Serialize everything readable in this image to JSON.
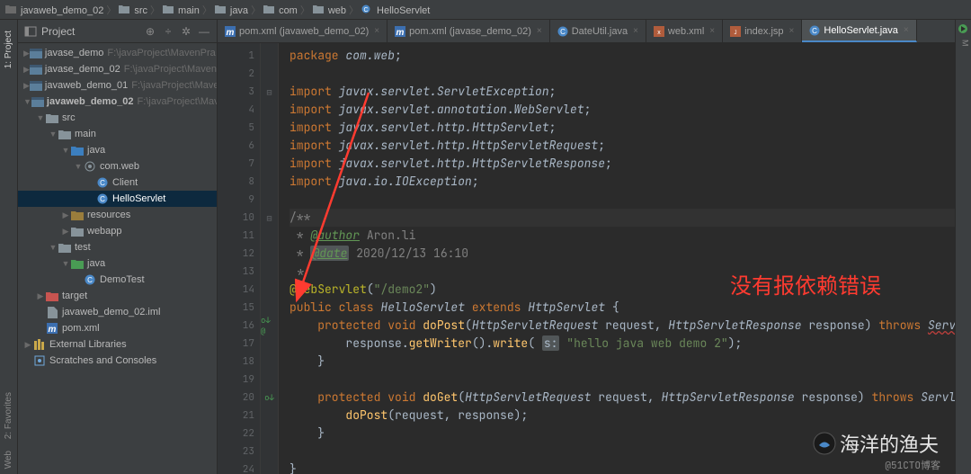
{
  "breadcrumb": [
    "javaweb_demo_02",
    "src",
    "main",
    "java",
    "com",
    "web",
    "HelloServlet"
  ],
  "project_panel": {
    "title": "Project",
    "tree": [
      {
        "depth": 0,
        "expand": "▶",
        "icon": "module",
        "label": "javase_demo",
        "dim": "F:\\javaProject\\MavenPra"
      },
      {
        "depth": 0,
        "expand": "▶",
        "icon": "module",
        "label": "javase_demo_02",
        "dim": "F:\\javaProject\\Maven"
      },
      {
        "depth": 0,
        "expand": "▶",
        "icon": "module",
        "label": "javaweb_demo_01",
        "dim": "F:\\javaProject\\Maver"
      },
      {
        "depth": 0,
        "expand": "▼",
        "icon": "module",
        "label": "javaweb_demo_02",
        "dim": "F:\\javaProject\\Maver",
        "bold": true
      },
      {
        "depth": 1,
        "expand": "▼",
        "icon": "folder",
        "label": "src"
      },
      {
        "depth": 2,
        "expand": "▼",
        "icon": "folder",
        "label": "main"
      },
      {
        "depth": 3,
        "expand": "▼",
        "icon": "src-folder",
        "label": "java"
      },
      {
        "depth": 4,
        "expand": "▼",
        "icon": "package",
        "label": "com.web"
      },
      {
        "depth": 5,
        "expand": "",
        "icon": "class",
        "label": "Client"
      },
      {
        "depth": 5,
        "expand": "",
        "icon": "class",
        "label": "HelloServlet",
        "sel": true
      },
      {
        "depth": 3,
        "expand": "▶",
        "icon": "res-folder",
        "label": "resources"
      },
      {
        "depth": 3,
        "expand": "▶",
        "icon": "folder",
        "label": "webapp"
      },
      {
        "depth": 2,
        "expand": "▼",
        "icon": "folder",
        "label": "test"
      },
      {
        "depth": 3,
        "expand": "▼",
        "icon": "test-folder",
        "label": "java"
      },
      {
        "depth": 4,
        "expand": "",
        "icon": "class",
        "label": "DemoTest"
      },
      {
        "depth": 1,
        "expand": "▶",
        "icon": "target",
        "label": "target"
      },
      {
        "depth": 1,
        "expand": "",
        "icon": "file",
        "label": "javaweb_demo_02.iml"
      },
      {
        "depth": 1,
        "expand": "",
        "icon": "maven",
        "label": "pom.xml"
      },
      {
        "depth": 0,
        "expand": "▶",
        "icon": "lib",
        "label": "External Libraries"
      },
      {
        "depth": 0,
        "expand": "",
        "icon": "scratch",
        "label": "Scratches and Consoles"
      }
    ]
  },
  "tabs": [
    {
      "icon": "maven",
      "label": "pom.xml (javaweb_demo_02)",
      "close": true
    },
    {
      "icon": "maven",
      "label": "pom.xml (javase_demo_02)",
      "close": true
    },
    {
      "icon": "class",
      "label": "DateUtil.java",
      "close": true
    },
    {
      "icon": "xml",
      "label": "web.xml",
      "close": true
    },
    {
      "icon": "jsp",
      "label": "index.jsp",
      "close": true
    },
    {
      "icon": "class",
      "label": "HelloServlet.java",
      "close": true,
      "active": true
    }
  ],
  "left_tool": [
    "1: Project",
    "2: Favorites",
    "Web"
  ],
  "code": {
    "lines": [
      {
        "n": 1,
        "html": "<span class='kw'>package</span> <span class='cls'>com.web</span>;"
      },
      {
        "n": 2,
        "html": ""
      },
      {
        "n": 3,
        "html": "<span class='kw'>import</span> <span class='cls'>javax.servlet.ServletException</span>;",
        "fold": "⊟"
      },
      {
        "n": 4,
        "html": "<span class='kw'>import</span> <span class='cls'>javax.servlet.annotation</span>.<span class='cls'>WebServlet</span>;"
      },
      {
        "n": 5,
        "html": "<span class='kw'>import</span> <span class='cls'>javax.servlet.http.HttpServlet</span>;"
      },
      {
        "n": 6,
        "html": "<span class='kw'>import</span> <span class='cls'>javax.servlet.http.HttpServletRequest</span>;"
      },
      {
        "n": 7,
        "html": "<span class='kw'>import</span> <span class='cls'>javax.servlet.http.HttpServletResponse</span>;"
      },
      {
        "n": 8,
        "html": "<span class='kw'>import</span> <span class='cls'>java.io.IOException</span>;"
      },
      {
        "n": 9,
        "html": ""
      },
      {
        "n": 10,
        "html": "<span class='line10'><span class='cmt'>/**</span></span>",
        "fold": "⊟"
      },
      {
        "n": 11,
        "html": "<span class='cmt'> * </span><span class='tag'>@author</span><span class='cmt'> Aron.li</span>"
      },
      {
        "n": 12,
        "html": "<span class='cmt'> * </span><span class='hlbox tag'>@date</span><span class='cmt'> 2020/12/13 16:10</span>"
      },
      {
        "n": 13,
        "html": "<span class='cmt'> */</span>"
      },
      {
        "n": 14,
        "html": "<span class='ann'>@WebServlet</span>(<span class='str'>\"/demo2\"</span>)"
      },
      {
        "n": 15,
        "html": "<span class='kw'>public class</span> <span class='cls'>HelloServlet</span> <span class='kw'>extends</span> <span class='cls'>HttpServlet</span> {"
      },
      {
        "n": 16,
        "html": "    <span class='kw'>protected</span> <span class='kw'>void</span> <span class='fn'>doPost</span>(<span class='cls'>HttpServletRequest</span> <span class='par'>request</span>, <span class='cls'>HttpServletResponse</span> <span class='par'>response</span>) <span class='kw'>throws</span> <span class='cls err-underline'>ServletEx</span>",
        "mark": "o↓ @"
      },
      {
        "n": 17,
        "html": "        <span class='par'>response</span>.<span class='fn'>getWriter</span>().<span class='fn'>write</span>( <span class='hlbox'>s:</span> <span class='str'>\"hello java web demo 2\"</span>);"
      },
      {
        "n": 18,
        "html": "    }"
      },
      {
        "n": 19,
        "html": ""
      },
      {
        "n": 20,
        "html": "    <span class='kw'>protected</span> <span class='kw'>void</span> <span class='fn'>doGet</span>(<span class='cls'>HttpServletRequest</span> <span class='par'>request</span>, <span class='cls'>HttpServletResponse</span> <span class='par'>response</span>) <span class='kw'>throws</span> <span class='cls'>ServletExc</span>",
        "mark": "o↓"
      },
      {
        "n": 21,
        "html": "        <span class='fn'>doPost</span>(<span class='par'>request</span>, <span class='par'>response</span>);"
      },
      {
        "n": 22,
        "html": "    }"
      },
      {
        "n": 23,
        "html": ""
      },
      {
        "n": 24,
        "html": "}"
      }
    ]
  },
  "annotation": "没有报依赖错误",
  "watermark1": "海洋的渔夫",
  "watermark2": "@51CTO博客"
}
